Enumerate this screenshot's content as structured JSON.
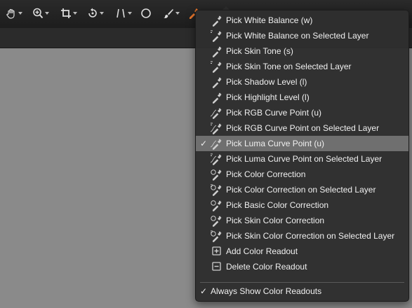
{
  "menu": {
    "items": [
      {
        "label": "Pick White Balance (w)",
        "icon": "eyedropper-icon",
        "layer": false
      },
      {
        "label": "Pick White Balance on Selected Layer",
        "icon": "eyedropper-layer-icon",
        "layer": true
      },
      {
        "label": "Pick Skin Tone (s)",
        "icon": "skin-eyedropper-icon",
        "layer": false
      },
      {
        "label": "Pick Skin Tone on Selected Layer",
        "icon": "skin-eyedropper-layer-icon",
        "layer": true
      },
      {
        "label": "Pick Shadow Level (l)",
        "icon": "shadow-eyedropper-icon",
        "layer": false
      },
      {
        "label": "Pick Highlight Level (l)",
        "icon": "highlight-eyedropper-icon",
        "layer": false
      },
      {
        "label": "Pick RGB Curve Point (u)",
        "icon": "curve-eyedropper-icon",
        "layer": false
      },
      {
        "label": "Pick RGB Curve Point on Selected Layer",
        "icon": "curve-eyedropper-layer-icon",
        "layer": true
      },
      {
        "label": "Pick Luma Curve Point (u)",
        "icon": "luma-eyedropper-icon",
        "layer": false,
        "checked": true
      },
      {
        "label": "Pick Luma Curve Point on Selected Layer",
        "icon": "luma-eyedropper-layer-icon",
        "layer": true
      },
      {
        "label": "Pick Color Correction",
        "icon": "color-correction-eyedropper-icon",
        "layer": false
      },
      {
        "label": "Pick Color Correction on Selected Layer",
        "icon": "color-correction-eyedropper-layer-icon",
        "layer": true
      },
      {
        "label": "Pick Basic Color Correction",
        "icon": "basic-color-correction-eyedropper-icon",
        "layer": false
      },
      {
        "label": "Pick Skin Color Correction",
        "icon": "skin-color-correction-eyedropper-icon",
        "layer": false
      },
      {
        "label": "Pick Skin Color Correction on Selected Layer",
        "icon": "skin-color-correction-eyedropper-layer-icon",
        "layer": true
      },
      {
        "label": "Add Color Readout",
        "icon": "add-readout-icon",
        "layer": false
      },
      {
        "label": "Delete Color Readout",
        "icon": "delete-readout-icon",
        "layer": false
      }
    ],
    "always_show": {
      "label": "Always Show Color Readouts",
      "check": "✓"
    },
    "selected_check": "✓"
  },
  "toolbar": {
    "tools": [
      "pan-icon",
      "zoom-icon",
      "crop-icon",
      "rotate-icon",
      "straighten-icon",
      "spot-icon",
      "brush-icon",
      "picker-icon"
    ]
  },
  "colors": {
    "accent": "#e8762c",
    "menu_bg": "#2e2e2e",
    "selected_bg": "#6f6f6f"
  }
}
